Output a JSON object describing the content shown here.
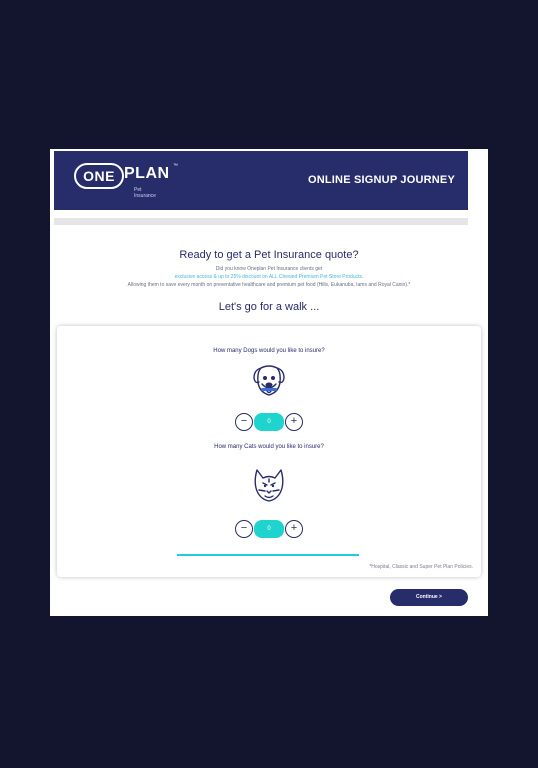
{
  "header": {
    "logo_one": "ONE",
    "logo_plan": "PLAN",
    "logo_tm": "™",
    "logo_sub": "Pet Insurance",
    "title": "ONLINE SIGNUP JOURNEY"
  },
  "intro": {
    "title": "Ready to get a Pet Insurance quote?",
    "line1": "Did you know Oneplan Pet Insurance clients get",
    "line2": "exclusive access & up to 25% discount on ALL Chewed Premium Pet Store Products.",
    "line3": "Allowing them to save every month on preventative healthcare and premium pet food (Hills, Eukanuba, Iams and Royal Canin).*"
  },
  "walk_title": "Let's go for a walk ...",
  "dogs": {
    "question": "How many Dogs would you like to insure?",
    "count": "0",
    "minus": "−",
    "plus": "+",
    "icon": "dog-icon"
  },
  "cats": {
    "question": "How many Cats would you like to insure?",
    "count": "0",
    "minus": "−",
    "plus": "+",
    "icon": "cat-icon"
  },
  "footnote": "*Hospital, Classic and Super Pet Plan Policies.",
  "continue_label": "Continue >",
  "colors": {
    "background": "#13152e",
    "brand": "#272c6b",
    "accent": "#1fd3cf",
    "link": "#4ab6d8"
  }
}
